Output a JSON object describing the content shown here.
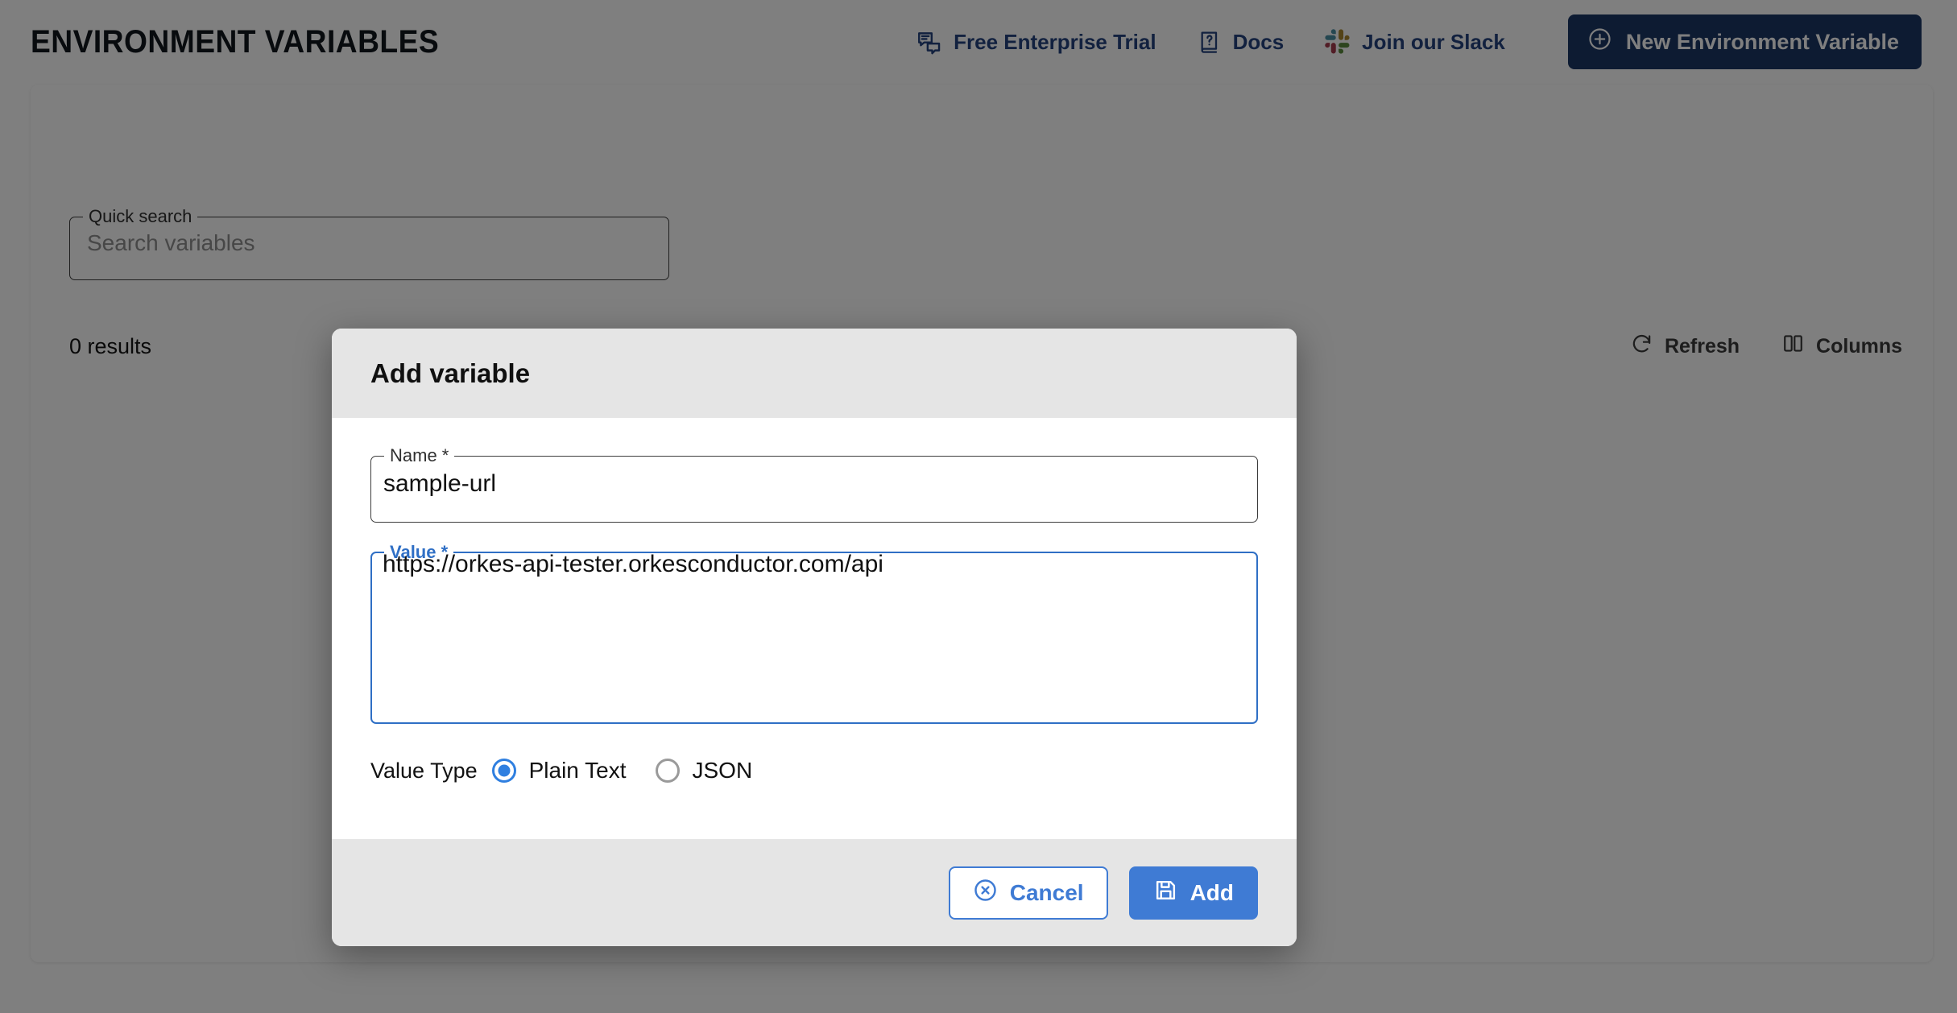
{
  "header": {
    "title": "ENVIRONMENT VARIABLES",
    "links": [
      {
        "label": "Free Enterprise Trial",
        "icon": "chat-bubbles-icon"
      },
      {
        "label": "Docs",
        "icon": "book-question-icon"
      },
      {
        "label": "Join our Slack",
        "icon": "slack-icon"
      }
    ],
    "primary_button": {
      "label": "New Environment Variable",
      "icon": "plus-circle-icon"
    },
    "link_color": "#24437e",
    "primary_button_color": "#1b3664"
  },
  "search": {
    "legend": "Quick search",
    "placeholder": "Search variables",
    "value": ""
  },
  "table_toolbar": {
    "results_text": "0 results",
    "refresh_label": "Refresh",
    "columns_label": "Columns"
  },
  "modal": {
    "title": "Add variable",
    "name_field": {
      "legend": "Name *",
      "value": "sample-url"
    },
    "value_field": {
      "legend": "Value *",
      "value": "https://orkes-api-tester.orkesconductor.com/api",
      "focused": true,
      "focus_color": "#2f6fc5"
    },
    "value_type": {
      "label": "Value Type",
      "options": [
        {
          "label": "Plain Text",
          "selected": true
        },
        {
          "label": "JSON",
          "selected": false
        }
      ],
      "selected_color": "#2f7fe0"
    },
    "footer": {
      "cancel_label": "Cancel",
      "cancel_icon": "close-circle-icon",
      "add_label": "Add",
      "add_icon": "save-disk-icon",
      "accent_color": "#3f7bd4"
    }
  }
}
